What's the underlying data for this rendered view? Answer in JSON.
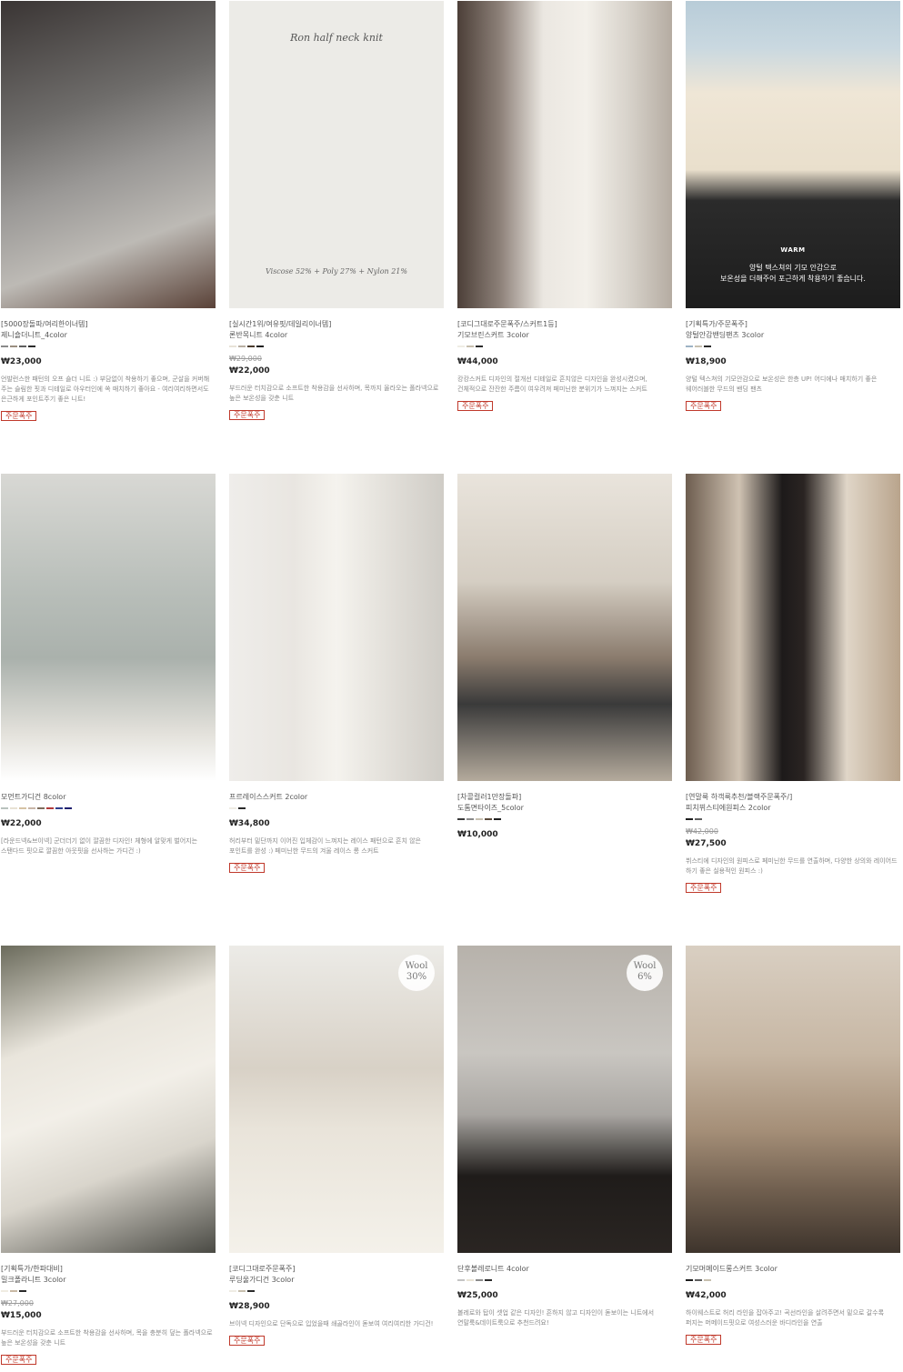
{
  "products": [
    {
      "tag": "[5000장돌파/여리한이너템]",
      "name": "제니숄더니트_4color",
      "old_price": "",
      "price": "₩23,000",
      "desc": "언발런스한 패턴의 오프 숄더 니트 :) 부담없이 착용하기 좋으며, 군살을 커버해 주는 슬림한 핏과 디테일로 아우터인에 쏙 매치하기 좋아요 - 여리여리하면서도 은근하게 포인트주기 좋은 니트!",
      "badge": "주문폭주",
      "colors": [
        "#8a8a8a",
        "#9a8e80",
        "#5e5e5e",
        "#2b2b2b"
      ],
      "overlay_title": "",
      "overlay_foot": "",
      "wool": ""
    },
    {
      "tag": "[실시간1위/여유핏/데일리이너템]",
      "name": "론반목니트 4color",
      "old_price": "₩29,000",
      "price": "₩22,000",
      "desc": "부드러운 터치감으로 소프트한 착용감을 선사하며, 목까지 올라오는 폴라넥으로 높은 보온성을 갖춘 니트",
      "badge": "주문폭주",
      "colors": [
        "#e8e3d8",
        "#b9afa3",
        "#4a3b2d",
        "#1e1e1e"
      ],
      "overlay_title": "Ron half neck knit",
      "overlay_foot": "Viscose 52% + Poly 27% + Nylon 21%",
      "wool": ""
    },
    {
      "tag": "[코디그대로주문폭주/스커트1등]",
      "name": "기모브린스커트 3color",
      "old_price": "",
      "price": "₩44,000",
      "desc": "캉캉스커트 디자인의 절개선 디테일로 흔치않은 디자인을 완성시켰으며, 건체적으로 잔잔한 주름이 여우려져 페미닌한 분위기가 느껴지는 스커트",
      "badge": "주문폭주",
      "colors": [
        "#efece4",
        "#c7bfae",
        "#2a2a2a"
      ],
      "overlay_title": "",
      "overlay_foot": "",
      "wool": ""
    },
    {
      "tag": "[기획특가/주문폭주]",
      "name": "양털안감밴딩팬츠 3color",
      "old_price": "",
      "price": "₩18,900",
      "desc": "양털 텍스쳐의 기모안감으로 보온성은 한층 UP! 어디에나 매치하기 좋은 웨어러블한 무드의 밴딩 팬츠",
      "badge": "주문폭주",
      "colors": [
        "#9db3c4",
        "#c7c0b0",
        "#2a2a2a"
      ],
      "overlay_title": "",
      "overlay_foot": "",
      "wool": "",
      "warm_label": "WARM",
      "warm_text_1": "양털 텍스쳐의 기모 안감으로",
      "warm_text_2": "보온성을 더해주어 포근하게 착용하기 좋습니다."
    },
    {
      "tag": "",
      "name": "모먼트가디건 8color",
      "old_price": "",
      "price": "₩22,000",
      "desc": "[라운드넥&브이넥] 군더더기 없이 깔끔한 디자인! 체형에 알맞게 벌어지는 스탠다드 핏으로 깔끔한 아웃핏을 선사하는 가디건 :)",
      "badge": "",
      "colors": [
        "#b9c2bd",
        "#e8e2d4",
        "#d6c3a4",
        "#c8b6a8",
        "#7e6c5c",
        "#b23a3a",
        "#2e3e8c",
        "#1e1e6e"
      ],
      "overlay_title": "",
      "overlay_foot": "",
      "wool": ""
    },
    {
      "tag": "",
      "name": "프르레이스스커트 2color",
      "old_price": "",
      "price": "₩34,800",
      "desc": "허리부터 밑단까지 이어진 입체감이 느껴지는 레이스 패턴으로 흔치 않은 포인트를 완성 :) 페미닌한 무드의 겨울 레이스 롱 스커트",
      "badge": "주문폭주",
      "colors": [
        "#efece4",
        "#2a2a2a"
      ],
      "overlay_title": "",
      "overlay_foot": "",
      "wool": ""
    },
    {
      "tag": "[차콜컬러1만장돌파]",
      "name": "도톰면타이즈_5color",
      "old_price": "",
      "price": "₩10,000",
      "desc": "",
      "badge": "",
      "colors": [
        "#3a3a3a",
        "#8a8a8a",
        "#c7c0b0",
        "#5a4a3c",
        "#1e1e1e"
      ],
      "overlay_title": "",
      "overlay_foot": "",
      "wool": ""
    },
    {
      "tag": "[연말룩 하객룩추천/블랙주문폭주/]",
      "name": "피치뷔스티에원피스 2color",
      "old_price": "₩42,000",
      "price": "₩27,500",
      "desc": "뷔스티에 디자인의 원피스로 페미닌한 무드를 연출하며, 다양한 상의와 레이어드 하기 좋은 실용적인 원피스 :)",
      "badge": "주문폭주",
      "colors": [
        "#1e1e1e",
        "#5e5e5e"
      ],
      "overlay_title": "",
      "overlay_foot": "",
      "wool": ""
    },
    {
      "tag": "[기획특가/한파대비]",
      "name": "밀크폴라니트 3color",
      "old_price": "₩27,000",
      "price": "₩15,000",
      "desc": "부드러운 터치감으로 소프트한 착용감을 선사하며, 목을 충분히 덮는 폴라넥으로 높은 보온성을 갖춘 니트",
      "badge": "주문폭주",
      "colors": [
        "#f0ece2",
        "#c9b9a4",
        "#2a2a2a"
      ],
      "overlay_title": "",
      "overlay_foot": "",
      "wool": ""
    },
    {
      "tag": "[코디그대로주문폭주]",
      "name": "루딩울가디건 3color",
      "old_price": "",
      "price": "₩28,900",
      "desc": "브이넥 디자인으로 단독으로 입었을때 쇄골라인이 돋보여 여리여리한 가디건!",
      "badge": "주문폭주",
      "colors": [
        "#efece4",
        "#c7bfae",
        "#2a2a2a"
      ],
      "overlay_title": "",
      "overlay_foot": "",
      "wool": "Wool 30%"
    },
    {
      "tag": "",
      "name": "단후볼레로니트 4color",
      "old_price": "",
      "price": "₩25,000",
      "desc": "볼레로와 탑이 셋업 같은 디자인! 흔하지 않고 디자인이 돋보이는 니트에서 연말룩&데이트룩으로 추천드려요!",
      "badge": "",
      "colors": [
        "#c4c4c4",
        "#e8e2d4",
        "#8a8a8a",
        "#2a2a2a"
      ],
      "overlay_title": "",
      "overlay_foot": "",
      "wool": "Wool 6%"
    },
    {
      "tag": "",
      "name": "기모머메이드롱스커트 3color",
      "old_price": "",
      "price": "₩42,000",
      "desc": "하이웨스트로 허리 라인을 잡아주고! 곡선라인을 살려주면서 밑으로 갈수록 퍼지는 머메이드핏으로 여성스러운 바디라인을 연출",
      "badge": "주문폭주",
      "colors": [
        "#1e1e1e",
        "#5e5e5e",
        "#c7bfae"
      ],
      "overlay_title": "",
      "overlay_foot": "",
      "wool": ""
    }
  ]
}
